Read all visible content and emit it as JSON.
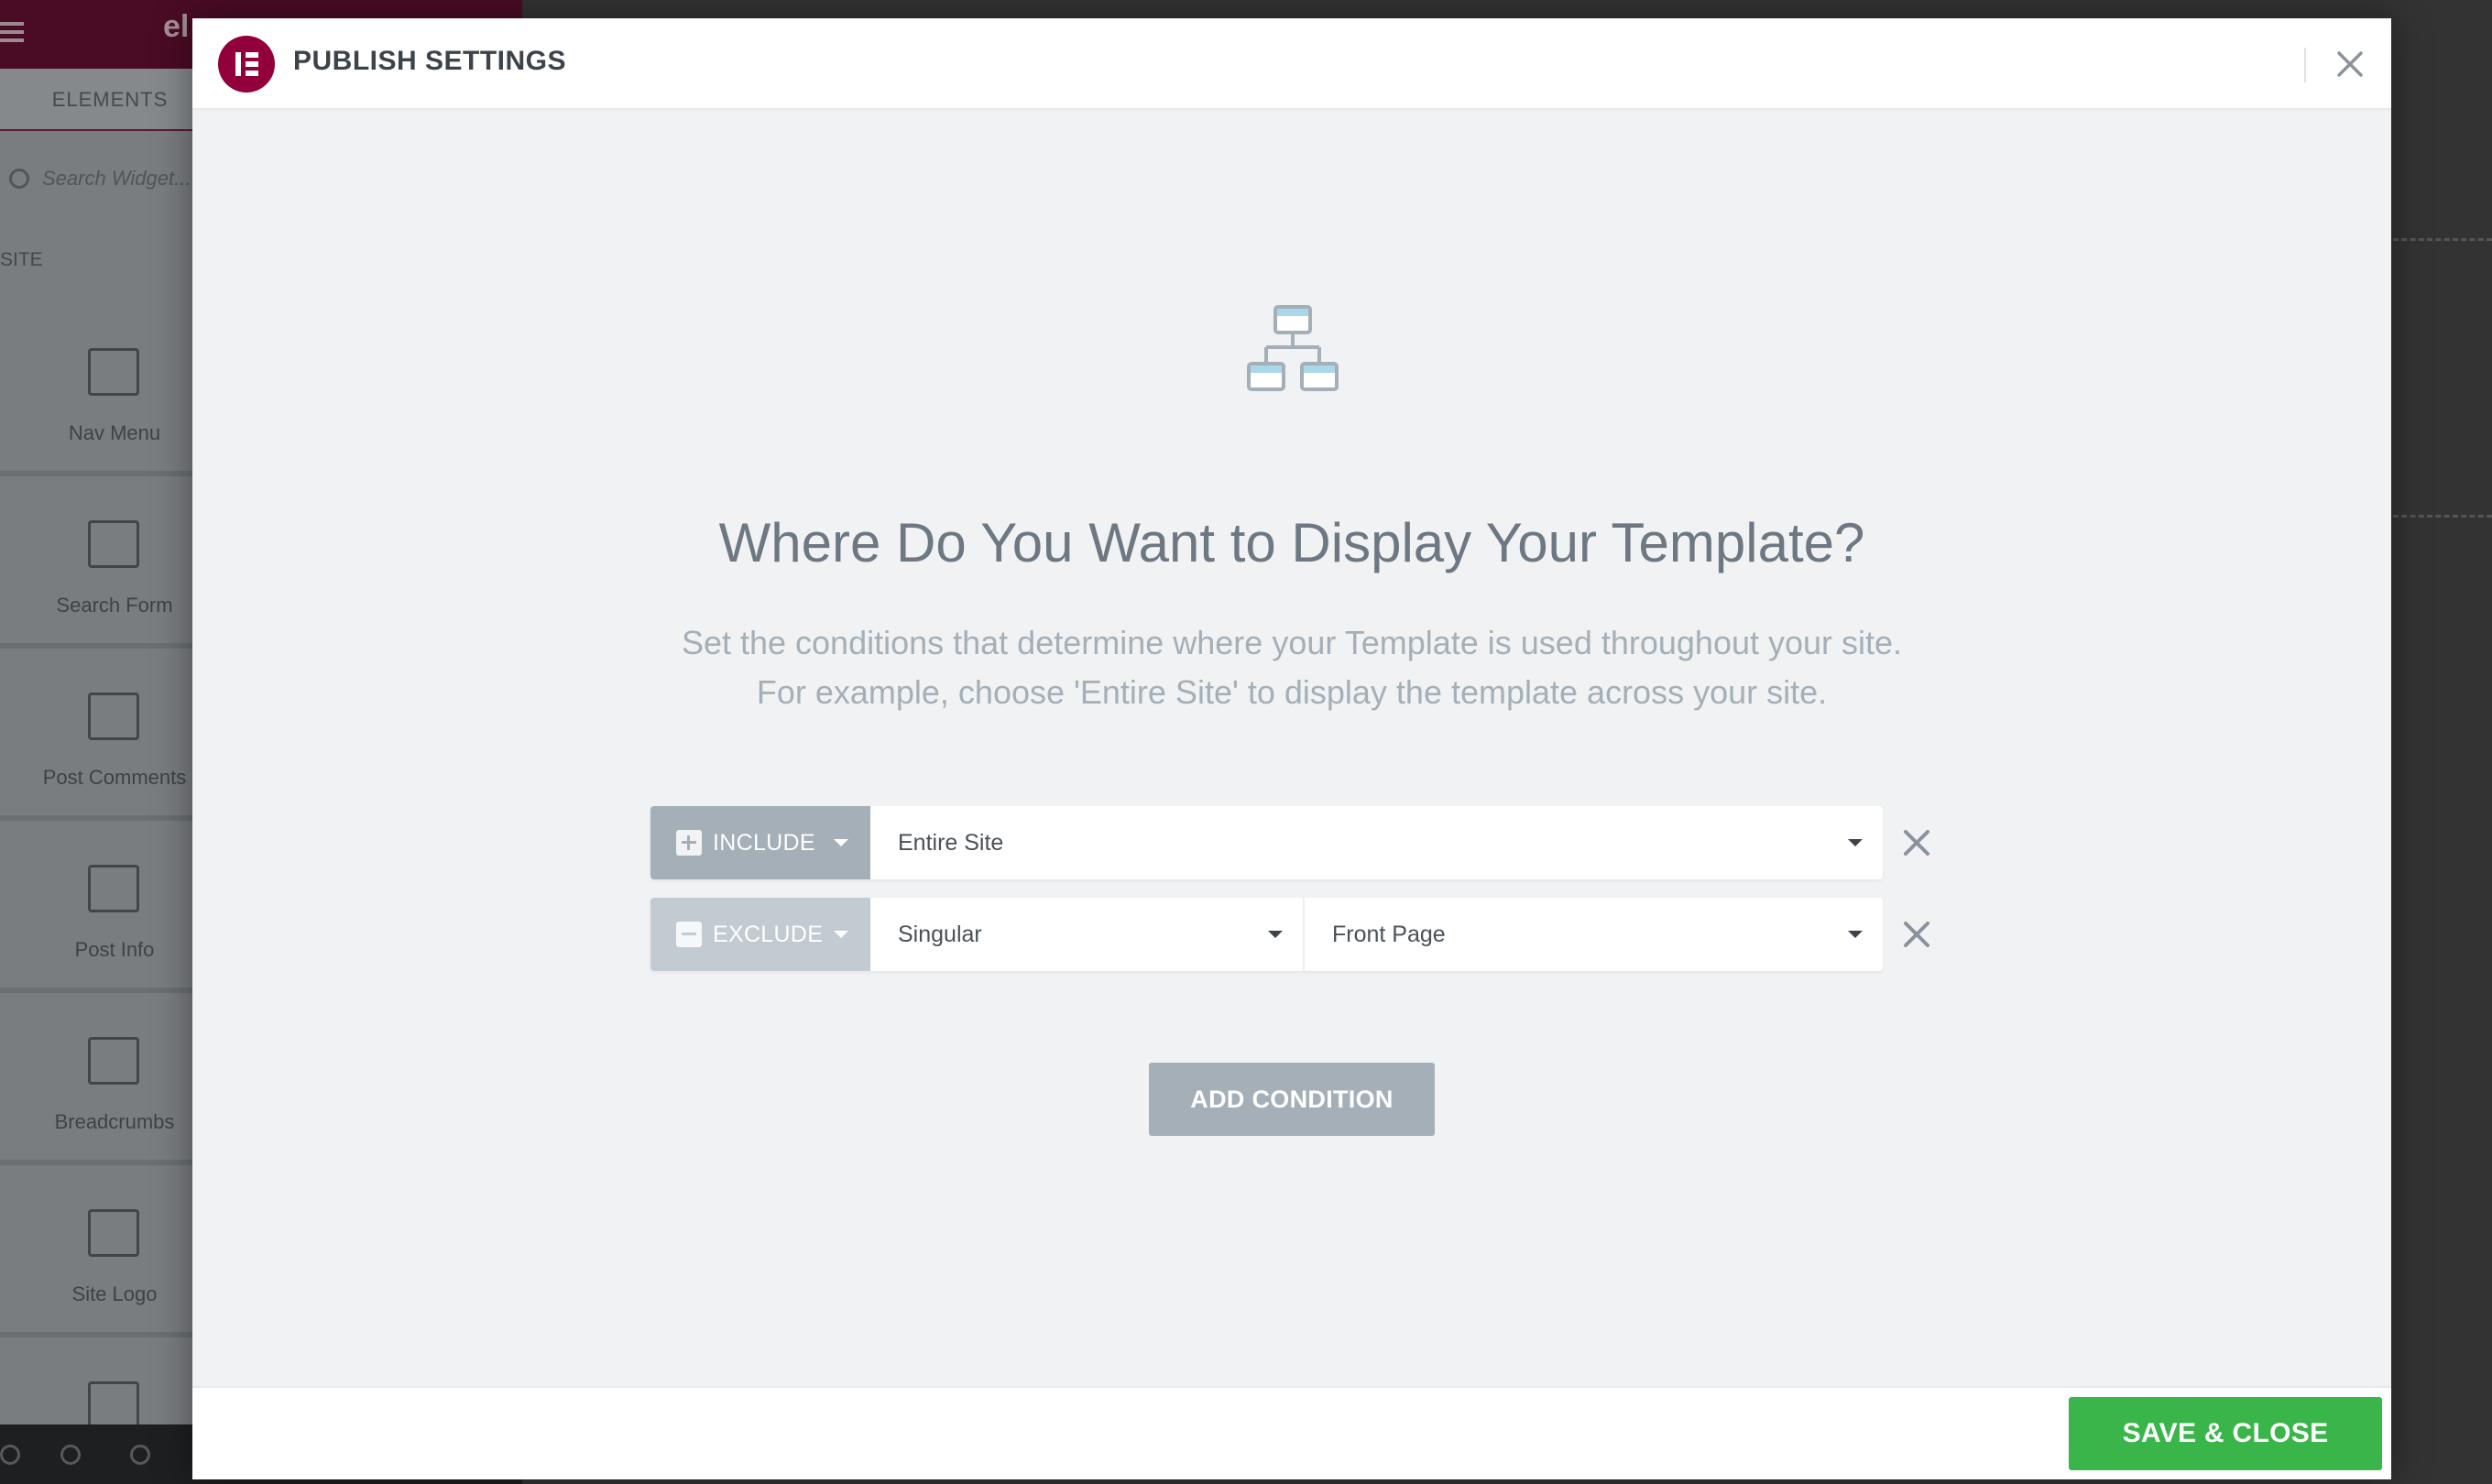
{
  "background": {
    "logo_text": "el",
    "tab_elements": "ELEMENTS",
    "search_placeholder": "Search Widget...",
    "section_label": "SITE",
    "widgets": [
      "Nav Menu",
      "Search Form",
      "Post Comments",
      "Post Info",
      "Breadcrumbs",
      "Site Logo",
      ""
    ]
  },
  "modal": {
    "title": "PUBLISH SETTINGS",
    "heading": "Where Do You Want to Display Your Template?",
    "description_line1": "Set the conditions that determine where your Template is used throughout your site.",
    "description_line2": "For example, choose 'Entire Site' to display the template across your site.",
    "conditions": [
      {
        "type": "INCLUDE",
        "value": "Entire Site"
      },
      {
        "type": "EXCLUDE",
        "sub": "Singular",
        "value": "Front Page"
      }
    ],
    "add_condition_label": "ADD CONDITION",
    "save_close_label": "SAVE & CLOSE"
  },
  "colors": {
    "brand": "#92003b",
    "save_green": "#39b54a",
    "include_gray": "#a4afb7",
    "exclude_gray": "#c2cbd2"
  },
  "icons": {
    "close": "close-icon",
    "sitemap": "sitemap-icon",
    "remove": "remove-condition-icon",
    "plus": "plus-icon",
    "minus": "minus-icon"
  }
}
